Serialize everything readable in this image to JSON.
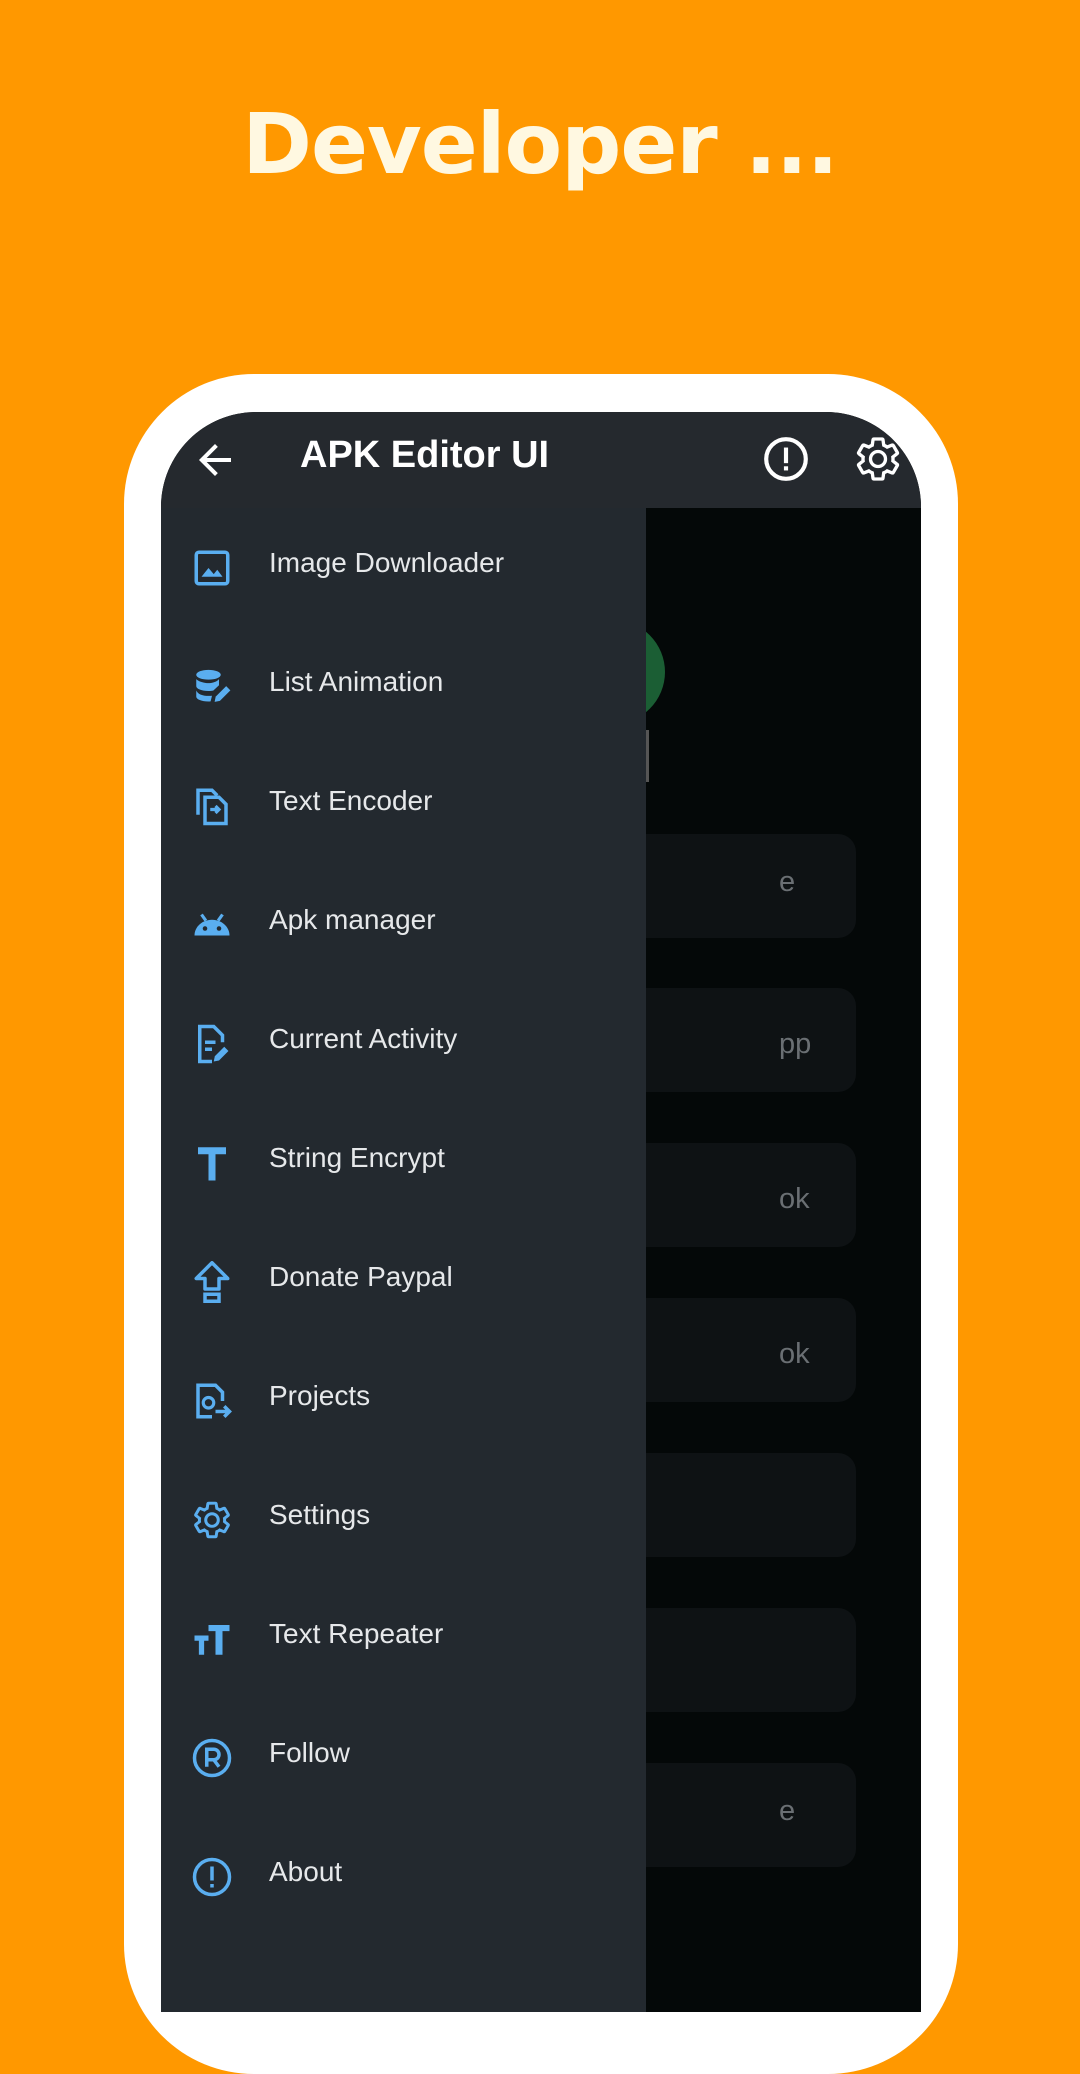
{
  "promo": {
    "title": "Developer ..."
  },
  "appbar": {
    "title": "APK Editor UI",
    "back_icon": "arrow-back-icon",
    "info_icon": "info-alert-icon",
    "settings_icon": "gear-icon"
  },
  "drawer": {
    "items": [
      {
        "label": "Image Downloader",
        "icon": "image-icon"
      },
      {
        "label": "List Animation",
        "icon": "database-edit-icon"
      },
      {
        "label": "Text Encoder",
        "icon": "file-swap-icon"
      },
      {
        "label": "Apk manager",
        "icon": "android-icon"
      },
      {
        "label": "Current Activity",
        "icon": "document-edit-icon"
      },
      {
        "label": "String Encrypt",
        "icon": "text-t-icon"
      },
      {
        "label": "Donate Paypal",
        "icon": "upload-arrow-icon"
      },
      {
        "label": "Projects",
        "icon": "file-export-icon"
      },
      {
        "label": "Settings",
        "icon": "gear-icon"
      },
      {
        "label": "Text Repeater",
        "icon": "text-size-icon"
      },
      {
        "label": "Follow",
        "icon": "registered-icon"
      },
      {
        "label": "About",
        "icon": "info-alert-icon"
      }
    ]
  },
  "background": {
    "cards": [
      "e",
      "pp",
      "ok",
      "ok",
      "",
      "",
      "e"
    ]
  },
  "colors": {
    "background": "#FF9800",
    "accent": "#5AAEF0",
    "drawer": "#23292F",
    "appbar": "#25292E"
  }
}
